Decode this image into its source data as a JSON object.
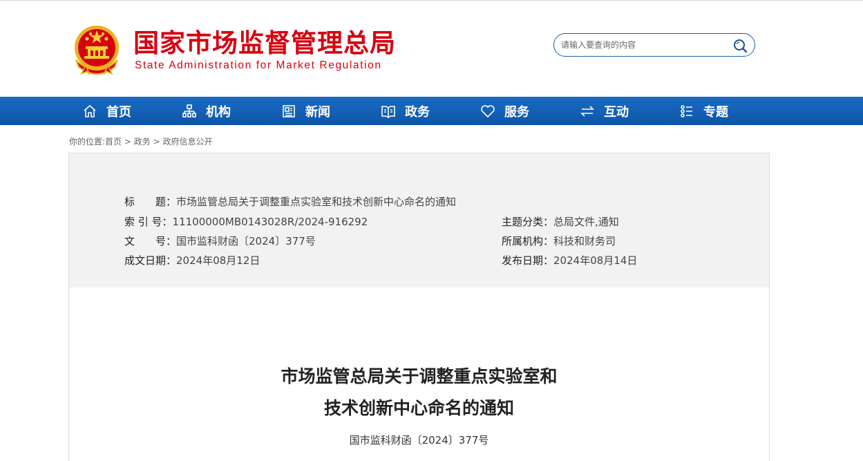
{
  "header": {
    "logo_cn": "国家市场监督管理总局",
    "logo_en": "State Administration for Market Regulation",
    "brand_color": "#d7000f"
  },
  "search": {
    "placeholder": "请输入要查询的内容",
    "icon": "search-icon"
  },
  "nav": {
    "bg_color": "#0d5fb5",
    "items": [
      {
        "label": "首页",
        "icon": "home-icon"
      },
      {
        "label": "机构",
        "icon": "org-chart-icon"
      },
      {
        "label": "新闻",
        "icon": "news-icon"
      },
      {
        "label": "政务",
        "icon": "government-icon"
      },
      {
        "label": "服务",
        "icon": "heart-icon"
      },
      {
        "label": "互动",
        "icon": "exchange-arrows-icon"
      },
      {
        "label": "专题",
        "icon": "topic-list-icon"
      }
    ]
  },
  "breadcrumb": {
    "prefix": "你的位置:",
    "items": [
      "首页",
      "政务",
      "政府信息公开"
    ],
    "separator": " > "
  },
  "meta": {
    "title_label": "标　　题：",
    "title_value": "市场监管总局关于调整重点实验室和技术创新中心命名的通知",
    "index_label": "索 引 号：",
    "index_value": "11100000MB0143028R/2024-916292",
    "docno_label": "文　　号：",
    "docno_value": "国市监科财函〔2024〕377号",
    "written_label": "成文日期：",
    "written_value": "2024年08月12日",
    "category_label": "主题分类：",
    "category_value": "总局文件,通知",
    "org_label": "所属机构：",
    "org_value": "科技和财务司",
    "publish_label": "发布日期：",
    "publish_value": "2024年08月14日"
  },
  "article": {
    "title_line1": "市场监管总局关于调整重点实验室和",
    "title_line2": "技术创新中心命名的通知",
    "doc_number": "国市监科财函〔2024〕377号"
  }
}
